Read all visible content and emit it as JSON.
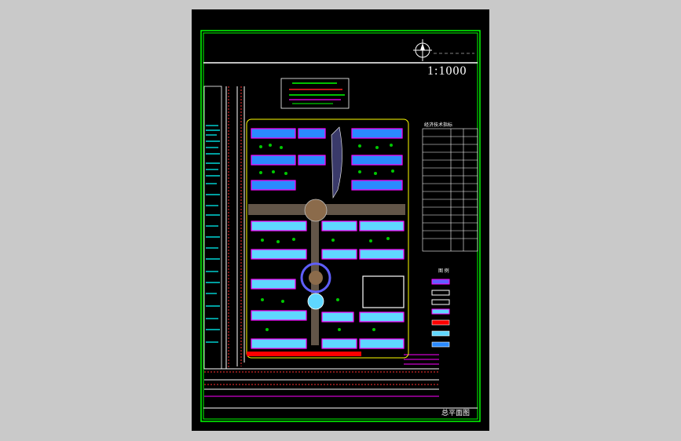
{
  "drawing": {
    "scale": "1:1000",
    "title": "总平面图",
    "legend_title": "图  例",
    "table_title": "经济技术指标",
    "north_arrow": "north-arrow-icon"
  },
  "colors": {
    "background": "#000000",
    "frame": "#00ff00",
    "buildings": "#ff00ff",
    "building_fill": "#5fd7ff",
    "road_edge": "#ffffff",
    "plaza": "#a0522d",
    "red_wall": "#ff0000",
    "cyan_lines": "#00ffff",
    "green_tree": "#00c800"
  }
}
